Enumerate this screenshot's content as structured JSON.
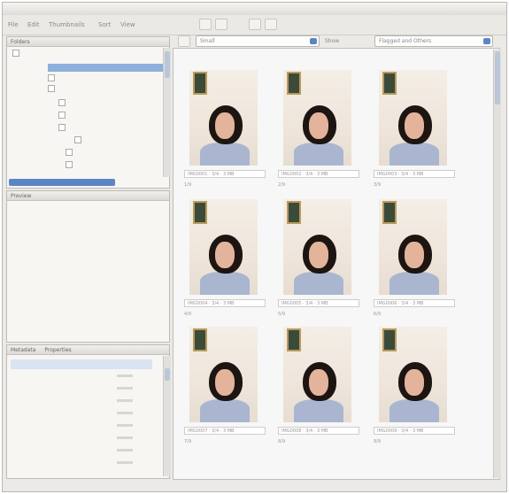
{
  "menubar": {
    "items": [
      "File",
      "Edit",
      "Thumbnails",
      "Sort",
      "View"
    ]
  },
  "panels": {
    "folders": {
      "header": "Folders"
    },
    "preview": {
      "header": "Preview"
    },
    "metadata": {
      "tabs": [
        "Metadata",
        "Properties"
      ]
    }
  },
  "view_toolbar": {
    "zoom_value": "Small",
    "show_label": "Show",
    "filter_value": "Flagged and Others"
  },
  "thumbnails": [
    {
      "caption": "IMG0001 · 3/4 · 3 MB",
      "index": "1/9"
    },
    {
      "caption": "IMG0002 · 3/4 · 3 MB",
      "index": "2/9"
    },
    {
      "caption": "IMG0003 · 3/4 · 3 MB",
      "index": "3/9"
    },
    {
      "caption": "IMG0004 · 3/4 · 3 MB",
      "index": "4/9"
    },
    {
      "caption": "IMG0005 · 3/4 · 3 MB",
      "index": "5/9"
    },
    {
      "caption": "IMG0006 · 3/4 · 3 MB",
      "index": "6/9"
    },
    {
      "caption": "IMG0007 · 3/4 · 3 MB",
      "index": "7/9"
    },
    {
      "caption": "IMG0008 · 3/4 · 3 MB",
      "index": "8/9"
    },
    {
      "caption": "IMG0009 · 3/4 · 3 MB",
      "index": "9/9"
    }
  ],
  "colors": {
    "accent": "#5b86c3",
    "selection": "#8fb0dc",
    "panel": "#f7f6f3"
  }
}
